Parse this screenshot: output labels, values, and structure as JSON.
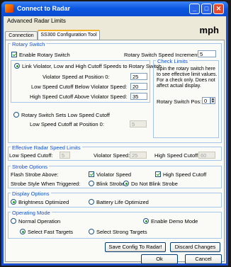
{
  "window": {
    "title": "Connect to Radar",
    "units": "mph"
  },
  "menu": [
    "Advanced",
    "Radar Limits"
  ],
  "tabs": [
    "Connection",
    "SS300 Configuration Tool"
  ],
  "rotary": {
    "group_title": "Rotary Switch",
    "enable_label": "Enable Rotary Switch",
    "enable_checked": true,
    "increment_label": "Rotary Switch Speed Increment:",
    "increment_value": "5",
    "link_option": "Link Violator, Low and High Cutoff Speeds to Rotary Switch",
    "link_selected": true,
    "violator_label": "Violator Speed at Position 0:",
    "violator_value": "25",
    "low_label": "Low Speed Cutoff Below Violator Speed:",
    "low_value": "20",
    "high_label": "High Speed Cutoff Above Violator Speed:",
    "high_value": "35",
    "sets_low_option": "Rotary Switch Sets Low Speed Cutoff",
    "sets_low_selected": false,
    "low_pos0_label": "Low Speed Cutoff at Position 0:",
    "low_pos0_value": "5",
    "check_limits": {
      "title": "Check Limits",
      "note": "Spin the rotary switch here to see effective limit values. For a check only. Does not affect actual display.",
      "pos_label": "Rotary Switch Pos:",
      "pos_value": "0"
    }
  },
  "effective": {
    "group_title": "Effective Radar Speed Limits",
    "low_label": "Low Speed Cutoff:",
    "low_value": "5",
    "violator_label": "Violator Speed:",
    "violator_value": "25",
    "high_label": "High Speed Cutoff:",
    "high_value": "60"
  },
  "strobe": {
    "group_title": "Strobe Options",
    "flash_label": "Flash Strobe Above:",
    "violator_label": "Violator Speed",
    "violator_checked": true,
    "high_label": "High Speed Cutoff",
    "high_checked": true,
    "style_label": "Strobe Style When Triggered:",
    "blink_label": "Blink Strobe",
    "blink_selected": false,
    "noblink_label": "Do Not Blink Strobe",
    "noblink_selected": true
  },
  "display": {
    "group_title": "Display Options",
    "brightness_label": "Brightness Optimized",
    "brightness_selected": true,
    "battery_label": "Battery Life Optimized",
    "battery_selected": false
  },
  "operating": {
    "group_title": "Operating Mode",
    "normal_label": "Normal Operation",
    "normal_selected": false,
    "demo_label": "Enable Demo Mode",
    "demo_selected": true,
    "fast_label": "Select Fast Targets",
    "fast_selected": true,
    "strong_label": "Select Strong Targets",
    "strong_selected": false
  },
  "buttons": {
    "save": "Save Config To Radar!",
    "discard": "Discard Changes",
    "ok": "Ok",
    "cancel": "Cancel"
  }
}
